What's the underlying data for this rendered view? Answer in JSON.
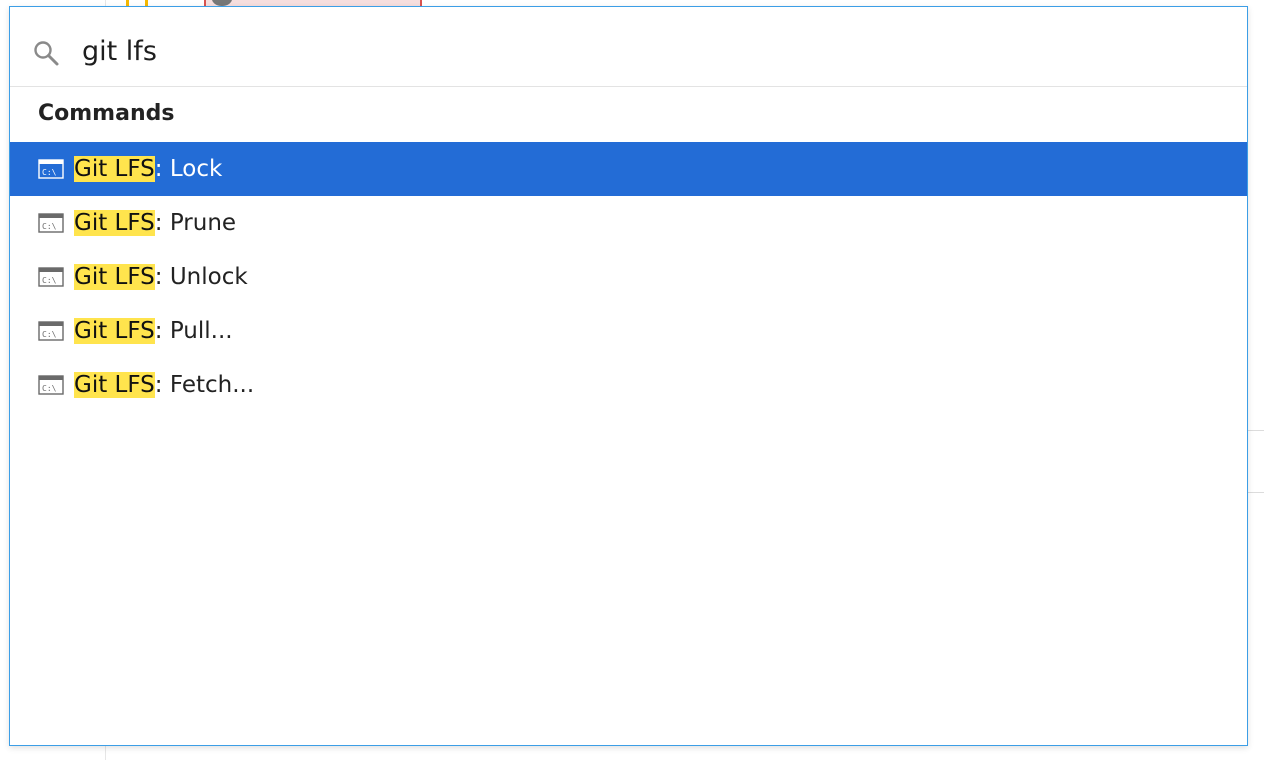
{
  "search": {
    "query": "git lfs"
  },
  "section": {
    "heading": "Commands"
  },
  "commands": [
    {
      "match": "Git LFS",
      "rest": ": Lock",
      "selected": true
    },
    {
      "match": "Git LFS",
      "rest": ": Prune",
      "selected": false
    },
    {
      "match": "Git LFS",
      "rest": ": Unlock",
      "selected": false
    },
    {
      "match": "Git LFS",
      "rest": ": Pull...",
      "selected": false
    },
    {
      "match": "Git LFS",
      "rest": ": Fetch...",
      "selected": false
    }
  ],
  "icons": {
    "search": "search-icon",
    "command": "terminal-icon"
  },
  "colors": {
    "accent_border": "#3c9ee6",
    "selected_bg": "#236cd6",
    "highlight": "#ffe44d"
  }
}
